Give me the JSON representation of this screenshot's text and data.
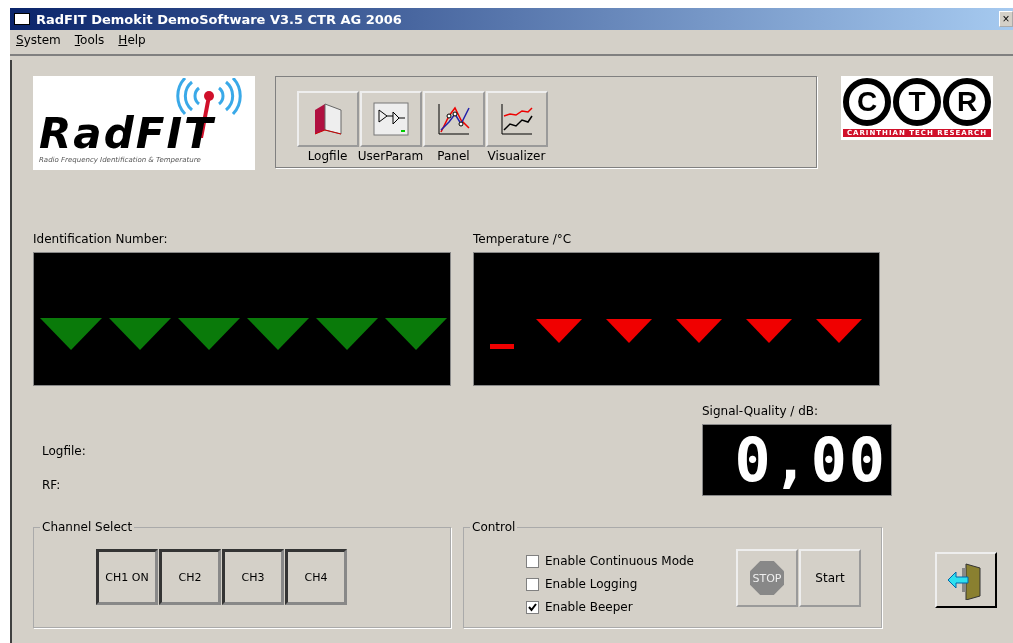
{
  "window": {
    "title": "RadFIT Demokit DemoSoftware V3.5 CTR AG 2006",
    "close": "×"
  },
  "menu": [
    {
      "label": "System"
    },
    {
      "label": "Tools"
    },
    {
      "label": "Help"
    }
  ],
  "logo": {
    "name": "RadFIT",
    "tagline": "Radio Frequency Identification & Temperature"
  },
  "toolbar": [
    {
      "label": "Logfile",
      "kind": "book"
    },
    {
      "label": "UserParam",
      "kind": "diagram"
    },
    {
      "label": "Panel",
      "kind": "plot"
    },
    {
      "label": "Visualizer",
      "kind": "lines"
    }
  ],
  "company_logo": {
    "letters": [
      "C",
      "T",
      "R"
    ],
    "name": "CARINTHIAN TECH RESEARCH"
  },
  "identification": {
    "label": "Identification Number:"
  },
  "temperature": {
    "label": "Temperature /°C",
    "negative": true
  },
  "signal": {
    "label": "Signal-Quality / dB:",
    "value": "0,00"
  },
  "info": [
    {
      "label": "Logfile:"
    },
    {
      "label": "RF:"
    }
  ],
  "channel_select": {
    "title": "Channel Select",
    "buttons": [
      {
        "label": "CH1 ON"
      },
      {
        "label": "CH2"
      },
      {
        "label": "CH3"
      },
      {
        "label": "CH4"
      }
    ]
  },
  "control": {
    "title": "Control",
    "options": [
      {
        "label": "Enable Continuous Mode",
        "checked": false
      },
      {
        "label": "Enable Logging",
        "checked": false
      },
      {
        "label": "Enable Beeper",
        "checked": true
      }
    ],
    "stop": "STOP",
    "start": "Start"
  }
}
